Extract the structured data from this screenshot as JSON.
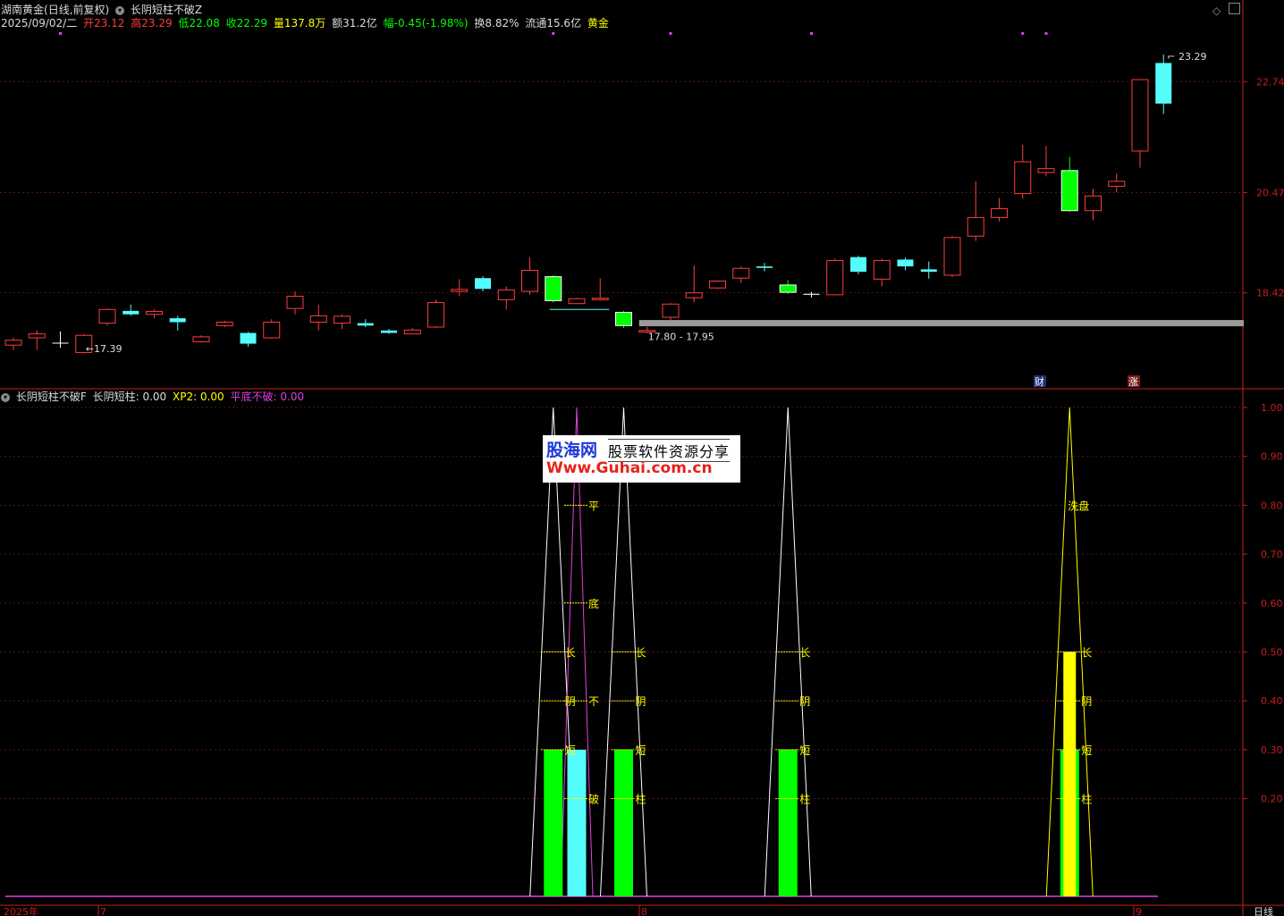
{
  "header": {
    "stock_name": "湖南黄金",
    "period_tag": "(日线,前复权)",
    "indicator_name": "长阴短柱不破Z",
    "date": "2025/09/02/二",
    "open_label": "开",
    "open": "23.12",
    "high_label": "高",
    "high": "23.29",
    "low_label": "低",
    "low": "22.08",
    "close_label": "收",
    "close": "22.29",
    "volume_label": "量",
    "volume": "137.8万",
    "amount_label": "额",
    "amount": "31.2亿",
    "change_label": "幅",
    "change": "-0.45(-1.98%)",
    "turnover_label": "换",
    "turnover": "8.82%",
    "float_label": "流通",
    "float": "15.6亿",
    "sector": "黄金"
  },
  "sub_header": {
    "indicator_name": "长阴短柱不破F",
    "v1_label": "长阴短柱:",
    "v1": "0.00",
    "v2_label": "XP2:",
    "v2": "0.00",
    "v3_label": "平底不破:",
    "v3": "0.00"
  },
  "watermark": {
    "brand": "股海网",
    "tagline": "股票软件资源分享",
    "url": "Www.Guhai.com.cn"
  },
  "colors": {
    "up": "#ff3c3c",
    "down_cyan": "#54fcfc",
    "down_green": "#00ff00",
    "yellow": "#ffff00",
    "magenta": "#e040e0",
    "white": "#ffffff",
    "gray_band": "#9a9a9a",
    "axis": "#c81e1e"
  },
  "chart_data": [
    {
      "type": "candlestick",
      "y_ticks": [
        "22.74",
        "20.47",
        "18.42"
      ],
      "y_tick_values": [
        22.74,
        20.47,
        18.42
      ],
      "ylim": [
        16.55,
        23.75
      ],
      "annotations": {
        "low_mark": "17.39",
        "high_mark": "23.29",
        "range_label": "17.80 - 17.95",
        "badge_cai": "财",
        "badge_zhang": "涨"
      },
      "support_band": 17.8,
      "candles": [
        {
          "o": 17.45,
          "h": 17.5,
          "l": 17.25,
          "c": 17.35,
          "t": "up"
        },
        {
          "o": 17.5,
          "h": 17.65,
          "l": 17.25,
          "c": 17.58,
          "t": "up"
        },
        {
          "o": 17.4,
          "h": 17.63,
          "l": 17.3,
          "c": 17.4,
          "t": "flat"
        },
        {
          "o": 17.2,
          "h": 17.58,
          "l": 17.18,
          "c": 17.55,
          "t": "up"
        },
        {
          "o": 17.8,
          "h": 18.1,
          "l": 17.75,
          "c": 18.08,
          "t": "up"
        },
        {
          "o": 18.05,
          "h": 18.18,
          "l": 17.95,
          "c": 17.98,
          "t": "down_cyan"
        },
        {
          "o": 17.98,
          "h": 18.08,
          "l": 17.9,
          "c": 18.04,
          "t": "up"
        },
        {
          "o": 17.9,
          "h": 17.95,
          "l": 17.65,
          "c": 17.82,
          "t": "down_cyan"
        },
        {
          "o": 17.42,
          "h": 17.55,
          "l": 17.4,
          "c": 17.52,
          "t": "up"
        },
        {
          "o": 17.75,
          "h": 17.85,
          "l": 17.72,
          "c": 17.82,
          "t": "up"
        },
        {
          "o": 17.6,
          "h": 17.62,
          "l": 17.32,
          "c": 17.38,
          "t": "down_cyan"
        },
        {
          "o": 17.5,
          "h": 17.88,
          "l": 17.48,
          "c": 17.82,
          "t": "up"
        },
        {
          "o": 18.1,
          "h": 18.45,
          "l": 17.98,
          "c": 18.35,
          "t": "up"
        },
        {
          "o": 17.82,
          "h": 18.18,
          "l": 17.65,
          "c": 17.95,
          "t": "up"
        },
        {
          "o": 17.8,
          "h": 17.98,
          "l": 17.68,
          "c": 17.94,
          "t": "up"
        },
        {
          "o": 17.8,
          "h": 17.88,
          "l": 17.72,
          "c": 17.75,
          "t": "down_cyan"
        },
        {
          "o": 17.65,
          "h": 17.68,
          "l": 17.58,
          "c": 17.6,
          "t": "down_cyan"
        },
        {
          "o": 17.58,
          "h": 17.7,
          "l": 17.58,
          "c": 17.66,
          "t": "up"
        },
        {
          "o": 17.72,
          "h": 18.28,
          "l": 17.7,
          "c": 18.22,
          "t": "up"
        },
        {
          "o": 18.45,
          "h": 18.7,
          "l": 18.35,
          "c": 18.49,
          "t": "up"
        },
        {
          "o": 18.72,
          "h": 18.76,
          "l": 18.45,
          "c": 18.5,
          "t": "down_cyan"
        },
        {
          "o": 18.28,
          "h": 18.55,
          "l": 18.08,
          "c": 18.48,
          "t": "up"
        },
        {
          "o": 18.45,
          "h": 19.15,
          "l": 18.38,
          "c": 18.88,
          "t": "up"
        },
        {
          "o": 18.75,
          "h": 18.78,
          "l": 18.22,
          "c": 18.26,
          "t": "down_green"
        },
        {
          "o": 18.2,
          "h": 18.32,
          "l": 18.2,
          "c": 18.3,
          "t": "up"
        },
        {
          "o": 18.28,
          "h": 18.72,
          "l": 18.26,
          "c": 18.31,
          "t": "up"
        },
        {
          "o": 18.02,
          "h": 18.05,
          "l": 17.7,
          "c": 17.75,
          "t": "down_green"
        },
        {
          "o": 17.65,
          "h": 17.72,
          "l": 17.59,
          "c": 17.62,
          "t": "up"
        },
        {
          "o": 17.92,
          "h": 18.21,
          "l": 17.85,
          "c": 18.19,
          "t": "up"
        },
        {
          "o": 18.32,
          "h": 18.98,
          "l": 18.22,
          "c": 18.42,
          "t": "up"
        },
        {
          "o": 18.52,
          "h": 18.68,
          "l": 18.5,
          "c": 18.66,
          "t": "up"
        },
        {
          "o": 18.72,
          "h": 18.96,
          "l": 18.62,
          "c": 18.92,
          "t": "up"
        },
        {
          "o": 18.96,
          "h": 19.03,
          "l": 18.86,
          "c": 18.93,
          "t": "down_cyan"
        },
        {
          "o": 18.58,
          "h": 18.68,
          "l": 18.4,
          "c": 18.43,
          "t": "down_green"
        },
        {
          "o": 18.4,
          "h": 18.44,
          "l": 18.32,
          "c": 18.38,
          "t": "flat"
        },
        {
          "o": 18.38,
          "h": 19.12,
          "l": 18.38,
          "c": 19.08,
          "t": "up"
        },
        {
          "o": 19.15,
          "h": 19.18,
          "l": 18.8,
          "c": 18.85,
          "t": "down_cyan"
        },
        {
          "o": 18.7,
          "h": 19.12,
          "l": 18.55,
          "c": 19.08,
          "t": "up"
        },
        {
          "o": 19.1,
          "h": 19.14,
          "l": 18.88,
          "c": 18.96,
          "t": "down_cyan"
        },
        {
          "o": 18.9,
          "h": 19.06,
          "l": 18.71,
          "c": 18.85,
          "t": "down_cyan"
        },
        {
          "o": 18.78,
          "h": 19.58,
          "l": 18.74,
          "c": 19.55,
          "t": "up"
        },
        {
          "o": 19.58,
          "h": 20.7,
          "l": 19.48,
          "c": 19.96,
          "t": "up"
        },
        {
          "o": 19.96,
          "h": 20.36,
          "l": 19.88,
          "c": 20.14,
          "t": "up"
        },
        {
          "o": 20.45,
          "h": 21.45,
          "l": 20.34,
          "c": 21.1,
          "t": "up"
        },
        {
          "o": 20.88,
          "h": 21.42,
          "l": 20.8,
          "c": 20.96,
          "t": "up"
        },
        {
          "o": 20.1,
          "h": 21.2,
          "l": 20.07,
          "c": 20.92,
          "t": "down_green"
        },
        {
          "o": 20.1,
          "h": 20.55,
          "l": 19.9,
          "c": 20.4,
          "t": "up"
        },
        {
          "o": 20.6,
          "h": 20.86,
          "l": 20.48,
          "c": 20.7,
          "t": "up"
        },
        {
          "o": 21.32,
          "h": 22.78,
          "l": 20.98,
          "c": 22.78,
          "t": "up"
        },
        {
          "o": 23.12,
          "h": 23.29,
          "l": 22.08,
          "c": 22.29,
          "t": "down_cyan"
        }
      ]
    },
    {
      "type": "indicator",
      "y_ticks": [
        "1.00",
        "0.90",
        "0.80",
        "0.70",
        "0.60",
        "0.50",
        "0.40",
        "0.30",
        "0.20"
      ],
      "y_tick_values": [
        1.0,
        0.9,
        0.8,
        0.7,
        0.6,
        0.5,
        0.4,
        0.3,
        0.2
      ],
      "ylim": [
        0.0,
        1.0
      ],
      "x_labels": [
        "2025年",
        "7",
        "8",
        "9",
        "日线"
      ],
      "bars": [
        {
          "i": 23,
          "v": 0.3,
          "color": "#00ff00"
        },
        {
          "i": 24,
          "v": 0.3,
          "color": "#54fcfc"
        },
        {
          "i": 26,
          "v": 0.3,
          "color": "#00ff00"
        },
        {
          "i": 33,
          "v": 0.3,
          "color": "#00ff00"
        },
        {
          "i": 45,
          "v": 0.3,
          "color": "#00ff00"
        },
        {
          "i": 45,
          "v": 0.5,
          "color": "#ffff00"
        }
      ],
      "spikes": [
        {
          "i": 23,
          "color": "#ffffff"
        },
        {
          "i": 24,
          "color": "#e040e0"
        },
        {
          "i": 26,
          "color": "#ffffff"
        },
        {
          "i": 33,
          "color": "#ffffff"
        },
        {
          "i": 45,
          "color": "#ffff00"
        }
      ],
      "labels": [
        {
          "i": 24,
          "v": 0.8,
          "text": "平",
          "color": "#ffff00"
        },
        {
          "i": 24,
          "v": 0.6,
          "text": "底",
          "color": "#ffff00"
        },
        {
          "i": 24,
          "v": 0.4,
          "text": "不",
          "color": "#ffff00"
        },
        {
          "i": 24,
          "v": 0.2,
          "text": "破",
          "color": "#ffff00"
        },
        {
          "i": 23,
          "v": 0.5,
          "text": "长",
          "color": "#ffff00"
        },
        {
          "i": 23,
          "v": 0.4,
          "text": "阴",
          "color": "#ffff00"
        },
        {
          "i": 23,
          "v": 0.3,
          "text": "短",
          "color": "#ffff00"
        },
        {
          "i": 26,
          "v": 0.5,
          "text": "长",
          "color": "#ffff00"
        },
        {
          "i": 26,
          "v": 0.4,
          "text": "阴",
          "color": "#ffff00"
        },
        {
          "i": 26,
          "v": 0.3,
          "text": "短",
          "color": "#ffff00"
        },
        {
          "i": 26,
          "v": 0.2,
          "text": "柱",
          "color": "#ffff00"
        },
        {
          "i": 33,
          "v": 0.5,
          "text": "长",
          "color": "#ffff00"
        },
        {
          "i": 33,
          "v": 0.4,
          "text": "阴",
          "color": "#ffff00"
        },
        {
          "i": 33,
          "v": 0.3,
          "text": "短",
          "color": "#ffff00"
        },
        {
          "i": 33,
          "v": 0.2,
          "text": "柱",
          "color": "#ffff00"
        },
        {
          "i": 45,
          "v": 0.8,
          "text": "洗盘",
          "color": "#ffff00"
        },
        {
          "i": 45,
          "v": 0.5,
          "text": "长",
          "color": "#ffff00"
        },
        {
          "i": 45,
          "v": 0.4,
          "text": "阴",
          "color": "#ffff00"
        },
        {
          "i": 45,
          "v": 0.3,
          "text": "短",
          "color": "#ffff00"
        },
        {
          "i": 45,
          "v": 0.2,
          "text": "柱",
          "color": "#ffff00"
        }
      ],
      "markers": [
        2,
        23,
        28,
        34,
        43,
        44
      ]
    }
  ]
}
